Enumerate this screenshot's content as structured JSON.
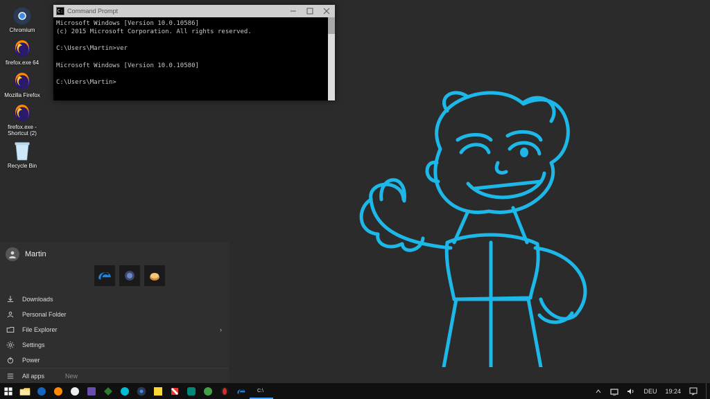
{
  "desktop": {
    "icons": [
      {
        "label": "Chromium"
      },
      {
        "label": "firefox.exe 64"
      },
      {
        "label": "Mozilla Firefox"
      },
      {
        "label": "firefox.exe - Shortcut (2)"
      },
      {
        "label": "Recycle Bin"
      }
    ]
  },
  "cmd": {
    "title": "Command Prompt",
    "lines": [
      "Microsoft Windows [Version 10.0.10586]",
      "(c) 2015 Microsoft Corporation. All rights reserved.",
      "",
      "C:\\Users\\Martin>ver",
      "",
      "Microsoft Windows [Version 10.0.10580]",
      "",
      "C:\\Users\\Martin>"
    ]
  },
  "start": {
    "user": "Martin",
    "items": [
      {
        "icon": "download",
        "label": "Downloads"
      },
      {
        "icon": "folder",
        "label": "Personal Folder"
      },
      {
        "icon": "explorer",
        "label": "File Explorer",
        "expand": true
      },
      {
        "icon": "gear",
        "label": "Settings"
      },
      {
        "icon": "power",
        "label": "Power"
      }
    ],
    "allapps": "All apps",
    "new": "New"
  },
  "taskbar": {
    "systray": {
      "lang": "DEU",
      "clock": "19:24"
    }
  }
}
